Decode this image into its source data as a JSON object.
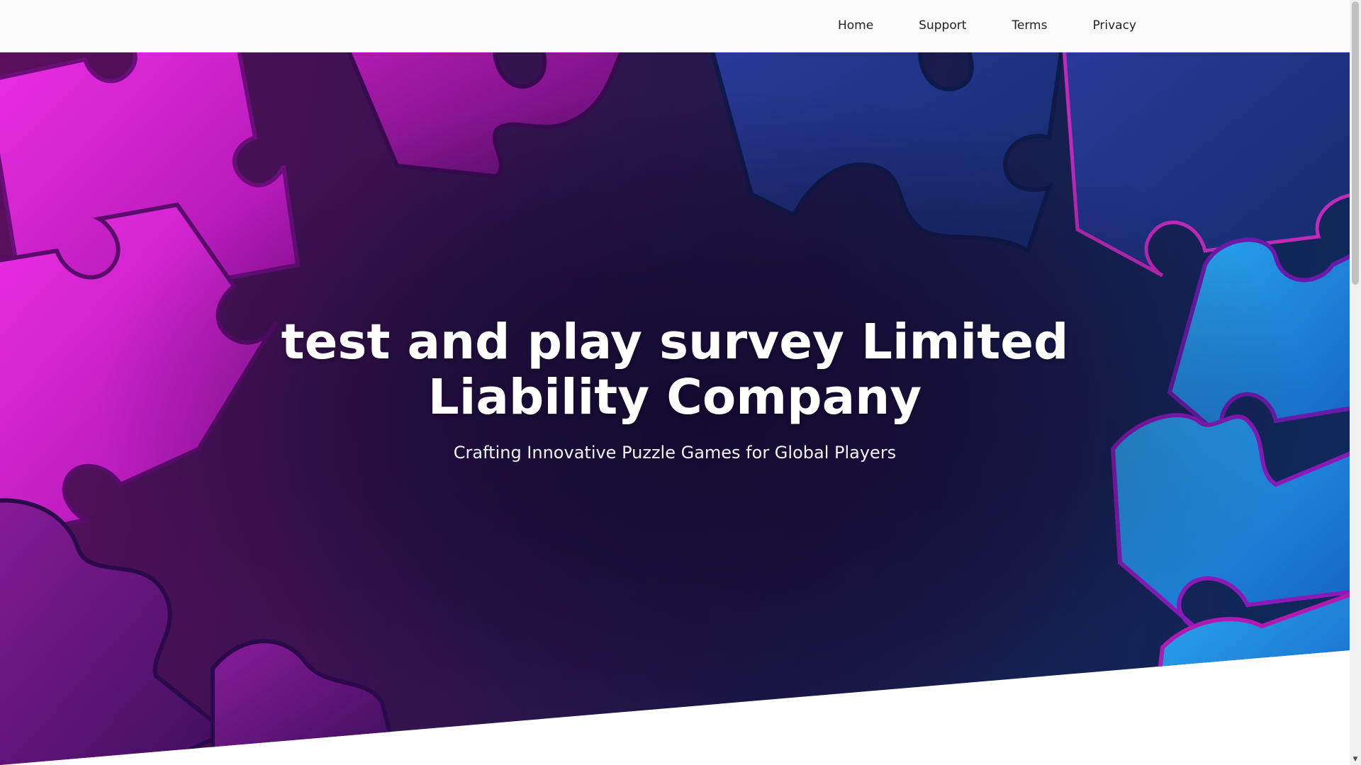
{
  "nav": {
    "items": [
      {
        "label": "Home"
      },
      {
        "label": "Support"
      },
      {
        "label": "Terms"
      },
      {
        "label": "Privacy"
      }
    ]
  },
  "hero": {
    "title": "test and play survey Limited Liability Company",
    "subtitle": "Crafting Innovative Puzzle Games for Global Players",
    "background_image": "puzzle-pieces-background"
  },
  "colors": {
    "header_bg": "#fafafa",
    "nav_text": "#222222",
    "hero_magenta": "#e020d8",
    "hero_blue": "#1aa8e8",
    "hero_dark": "#1a0f3a",
    "title_text": "#ffffff"
  },
  "scrollbar": {
    "down_arrow_icon": "chevron-down-icon"
  }
}
